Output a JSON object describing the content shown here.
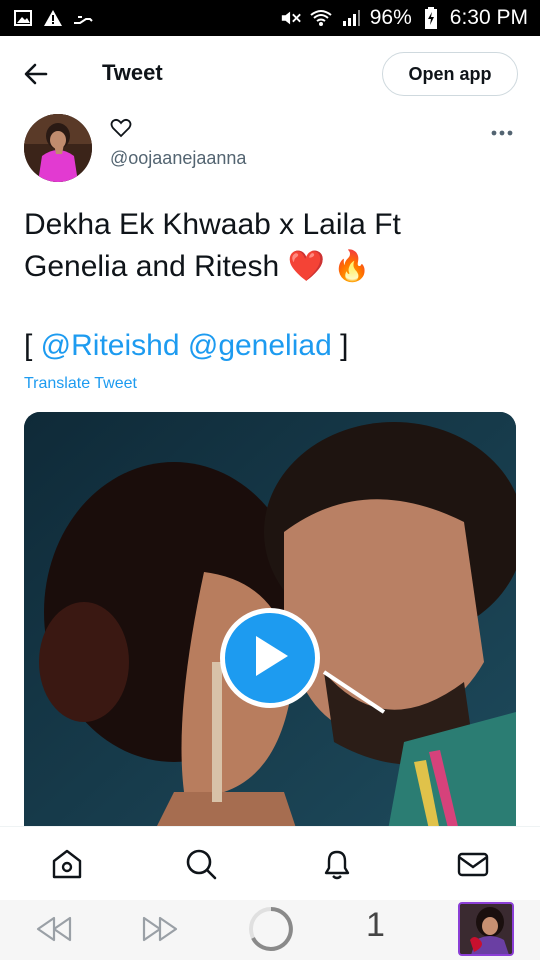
{
  "status": {
    "battery": "96%",
    "time": "6:30 PM"
  },
  "header": {
    "title": "Tweet",
    "open_app": "Open app"
  },
  "tweet": {
    "handle": "@oojaanejaanna",
    "text_line1": "Dekha Ek Khwaab x Laila Ft",
    "text_line2": "Genelia and Ritesh ❤️ 🔥",
    "bracket_open": "[ ",
    "mention1": "@Riteishd",
    "mention2": "@geneliad",
    "bracket_close": " ]",
    "translate": "Translate Tweet"
  },
  "browser": {
    "tab_count": "1"
  },
  "colors": {
    "accent": "#1d9bf0",
    "thumb_border": "#8b3fd6"
  }
}
